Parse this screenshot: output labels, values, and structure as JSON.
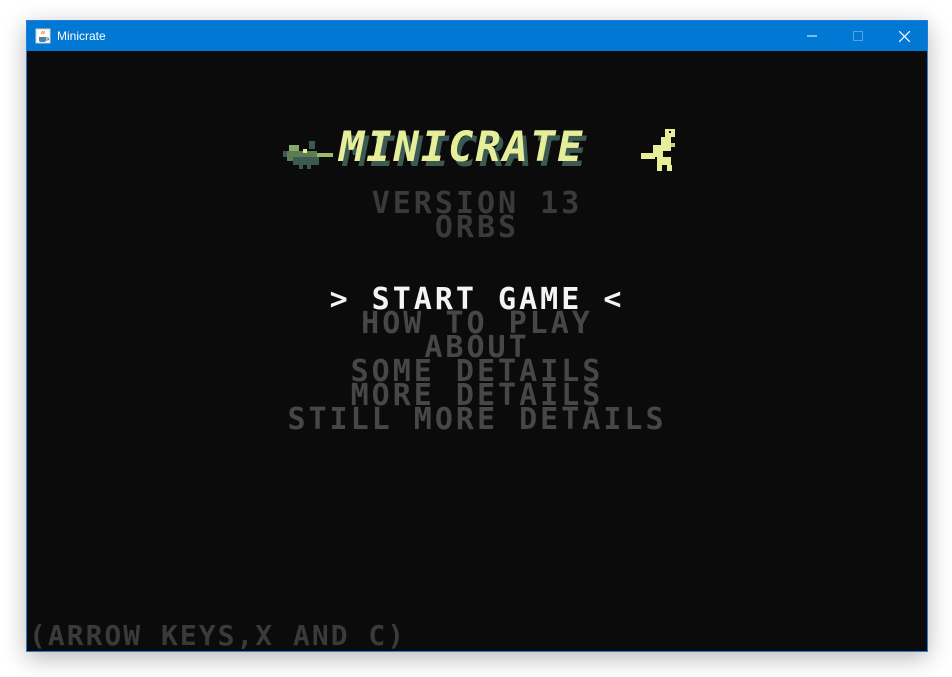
{
  "window": {
    "title": "Minicrate",
    "icon": "java-cup-icon",
    "controls": {
      "minimize_icon": "minimize-icon",
      "maximize_icon": "maximize-icon",
      "close_icon": "close-icon"
    }
  },
  "game": {
    "logo_text": "MINICRATE",
    "version": "VERSION 13",
    "subtitle": "ORBS",
    "menu": [
      {
        "label": "> START GAME <",
        "selected": true
      },
      {
        "label": "HOW TO PLAY",
        "selected": false
      },
      {
        "label": "ABOUT",
        "selected": false
      },
      {
        "label": "SOME DETAILS",
        "selected": false
      },
      {
        "label": "MORE DETAILS",
        "selected": false
      },
      {
        "label": "STILL MORE DETAILS",
        "selected": false
      }
    ],
    "hint": "(ARROW KEYS,X AND C)"
  },
  "colors": {
    "background": "#0b0b0b",
    "titlebar": "#0078d4",
    "logo_fill": "#e7ee9a",
    "logo_shadow": "#3c5a52",
    "menu_selected": "#f4f4f4",
    "menu_inactive": "#474747",
    "dim_text": "#3a3a3a"
  }
}
